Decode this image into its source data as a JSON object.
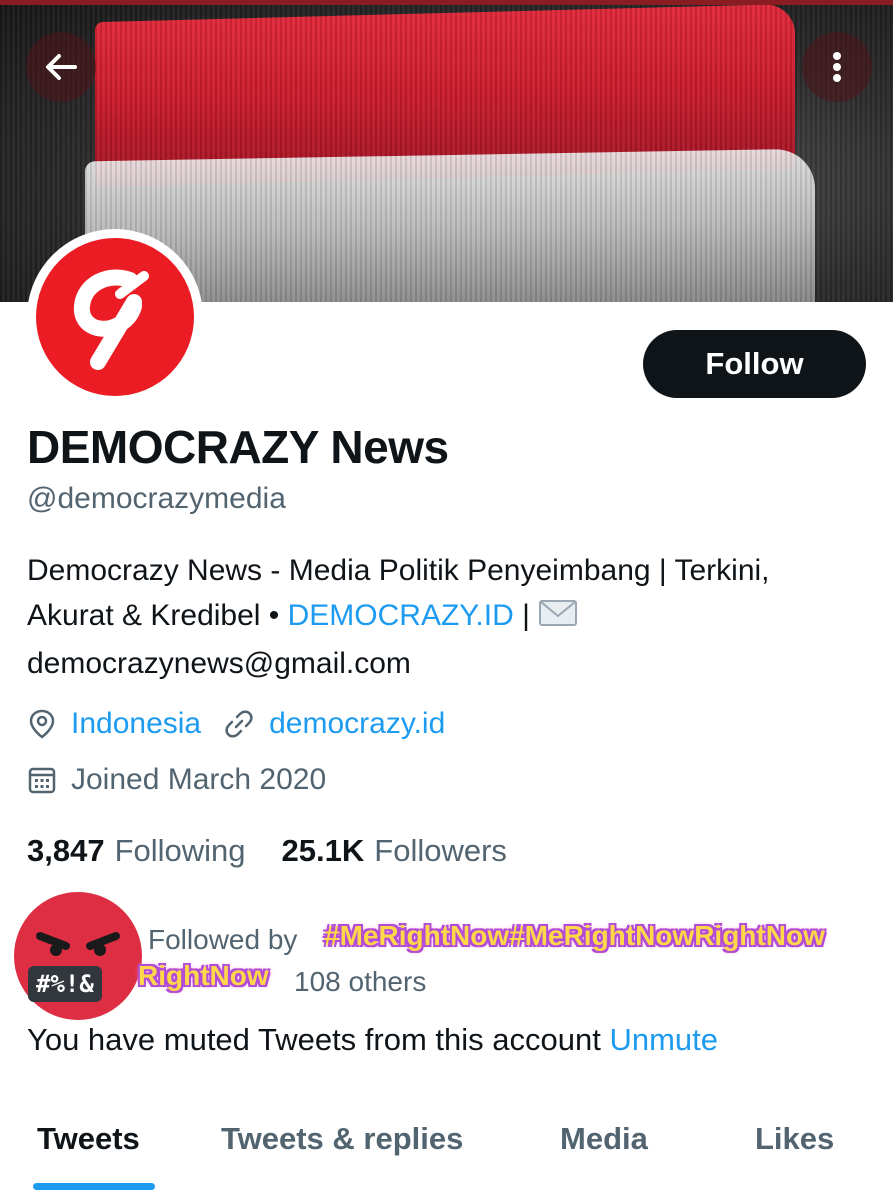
{
  "header": {
    "back_icon": "arrow-left-icon",
    "more_icon": "more-vertical-icon"
  },
  "profile": {
    "name": "DEMOCRAZY News",
    "handle": "@democrazymedia",
    "follow_label": "Follow",
    "avatar_icon": "democrazy-logo",
    "bio": {
      "text_part1": "Democrazy News - Media Politik Penyeimbang | Terkini, Akurat & Kredibel • ",
      "link": "DEMOCRAZY.ID",
      "text_part2": " | ",
      "email": "democrazynews@gmail.com"
    },
    "location": "Indonesia",
    "website": "democrazy.id",
    "joined": "Joined March 2020",
    "following_count": "3,847",
    "following_label": "Following",
    "followers_count": "25.1K",
    "followers_label": "Followers"
  },
  "followed_by": {
    "prefix": "Followed by",
    "suffix": "108 others",
    "overlay_line1": "#MeRightNow#MeRightNowRightNow",
    "overlay_line2": "RightNow",
    "emoji_label": "#%!&"
  },
  "muted": {
    "text": "You have muted Tweets from this account",
    "action": "Unmute"
  },
  "tabs": [
    {
      "label": "Tweets",
      "active": true
    },
    {
      "label": "Tweets & replies",
      "active": false
    },
    {
      "label": "Media",
      "active": false
    },
    {
      "label": "Likes",
      "active": false
    }
  ],
  "colors": {
    "accent": "#1d9bf0",
    "text": "#0f1419",
    "secondary": "#536471",
    "brand_red": "#ec1c24"
  }
}
